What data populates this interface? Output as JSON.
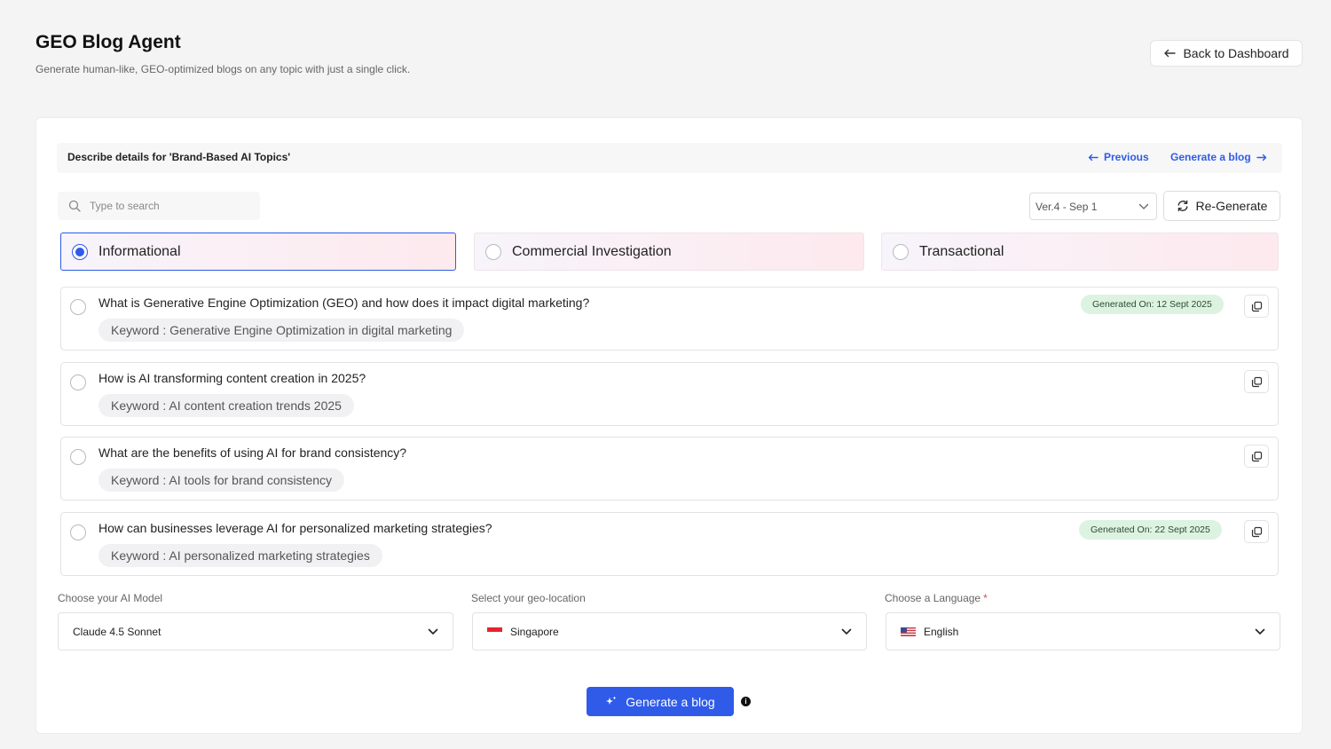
{
  "header": {
    "title": "GEO Blog Agent",
    "subtitle": "Generate human-like, GEO-optimized blogs on any topic with just a single click.",
    "back_label": "Back to Dashboard"
  },
  "panel": {
    "title": "Describe details for 'Brand-Based AI Topics'",
    "previous_label": "Previous",
    "next_label": "Generate a blog"
  },
  "search": {
    "placeholder": "Type to search",
    "value": ""
  },
  "version": {
    "selected": "Ver.4 - Sep 1"
  },
  "regenerate_label": "Re-Generate",
  "intents": [
    {
      "label": "Informational",
      "selected": true
    },
    {
      "label": "Commercial Investigation",
      "selected": false
    },
    {
      "label": "Transactional",
      "selected": false
    }
  ],
  "topics": [
    {
      "question": "What is Generative Engine Optimization (GEO) and how does it impact digital marketing?",
      "keyword": "Keyword : Generative Engine Optimization in digital marketing",
      "generated": "Generated On: 12 Sept 2025"
    },
    {
      "question": "How is AI transforming content creation in 2025?",
      "keyword": "Keyword : AI content creation trends 2025",
      "generated": ""
    },
    {
      "question": "What are the benefits of using AI for brand consistency?",
      "keyword": "Keyword : AI tools for brand consistency",
      "generated": ""
    },
    {
      "question": "How can businesses leverage AI for personalized marketing strategies?",
      "keyword": "Keyword : AI personalized marketing strategies",
      "generated": "Generated On: 22 Sept 2025"
    }
  ],
  "fields": {
    "model": {
      "label": "Choose your AI Model",
      "value": "Claude 4.5 Sonnet"
    },
    "geo": {
      "label": "Select your geo-location",
      "value": "Singapore"
    },
    "language": {
      "label": "Choose a Language",
      "required_mark": "*",
      "value": "English"
    }
  },
  "generate_label": "Generate a blog",
  "info_glyph": "i",
  "colors": {
    "accent": "#2f5be8",
    "badge_bg": "#dcf3e1"
  }
}
